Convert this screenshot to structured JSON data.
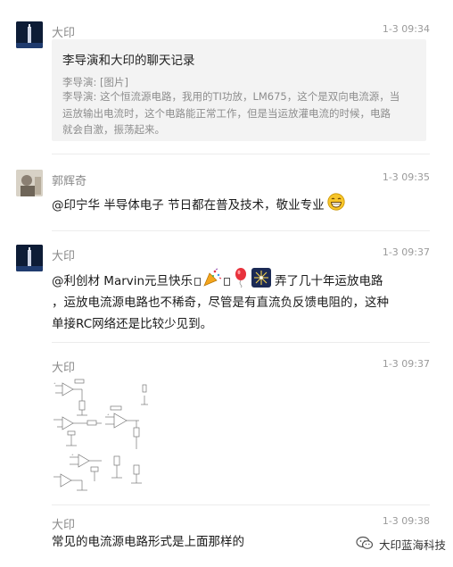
{
  "messages": [
    {
      "sender": "大印",
      "time": "1-3 09:34",
      "record": {
        "title": "李导演和大印的聊天记录",
        "line1": "李导演: [图片]",
        "line2": "李导演: 这个恒流源电路，我用的TI功放，LM675，这个是双向电流源，当",
        "line3": "运放输出电流时，这个电路能正常工作，但是当运放灌电流的时候，电路",
        "line4": "就会自激，振荡起来。"
      }
    },
    {
      "sender": "郭辉奇",
      "time": "1-3 09:35",
      "text": "@印宁华 半导体电子 节日都在普及技术，敬业专业"
    },
    {
      "sender": "大印",
      "time": "1-3 09:37",
      "text_part1": "@利创材 Marvin元旦快乐",
      "text_part2": "弄了几十年运放电路",
      "line2": "，运放电流源电路也不稀奇，尽管是有直流负反馈电阻的，这种",
      "line3": "单接RC网络还是比较少见到。"
    },
    {
      "sender": "大印",
      "time": "1-3 09:37",
      "image": "circuit-schematic"
    },
    {
      "sender": "大印",
      "time": "1-3 09:38",
      "text": "常见的电流源电路形式是上面那样的"
    }
  ],
  "watermark": {
    "text": "大印蓝海科技",
    "icon": "wechat-icon"
  },
  "colors": {
    "record_bg": "#f3f3f3",
    "time": "#9a9a9a",
    "sender": "#8a8a8a"
  }
}
